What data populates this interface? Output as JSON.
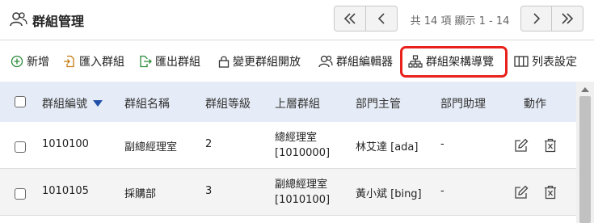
{
  "page": {
    "title": "群組管理",
    "title_icon": "users-icon"
  },
  "pager": {
    "info": "共 14 項 顯示 1 - 14",
    "first_icon": "double-chevron-left-icon",
    "prev_icon": "chevron-left-icon",
    "next_icon": "chevron-right-icon",
    "last_icon": "double-chevron-right-icon"
  },
  "toolbar": {
    "add": {
      "label": "新增",
      "icon": "plus-circle-icon"
    },
    "import": {
      "label": "匯入群組",
      "icon": "file-import-icon"
    },
    "export": {
      "label": "匯出群組",
      "icon": "file-export-icon"
    },
    "change_open": {
      "label": "變更群組開放",
      "icon": "lock-icon"
    },
    "editor": {
      "label": "群組編輯器",
      "icon": "users-icon"
    },
    "org_wizard": {
      "label": "群組架構導覽",
      "icon": "sitemap-icon"
    },
    "columns": {
      "label": "列表設定",
      "icon": "columns-icon"
    }
  },
  "table": {
    "headers": {
      "code": "群組編號",
      "name": "群組名稱",
      "level": "群組等級",
      "parent": "上層群組",
      "manager": "部門主管",
      "assistant": "部門助理",
      "actions": "動作"
    },
    "sort_icon": "caret-down-icon",
    "rows": [
      {
        "code": "1010100",
        "name": "副總經理室",
        "level": "2",
        "parent_line1": "總經理室",
        "parent_line2": "[1010000]",
        "manager": "林艾達 [ada]",
        "assistant": "-"
      },
      {
        "code": "1010105",
        "name": "採購部",
        "level": "3",
        "parent_line1": "副總經理室",
        "parent_line2": "[1010100]",
        "manager": "黃小斌 [bing]",
        "assistant": "-"
      }
    ],
    "edit_icon": "edit-icon",
    "delete_icon": "trash-icon"
  },
  "colors": {
    "accent": "#2f6fd1",
    "highlight": "#e8211c",
    "header_bg": "#e6ecf7",
    "even_row": "#f4f4f4"
  }
}
